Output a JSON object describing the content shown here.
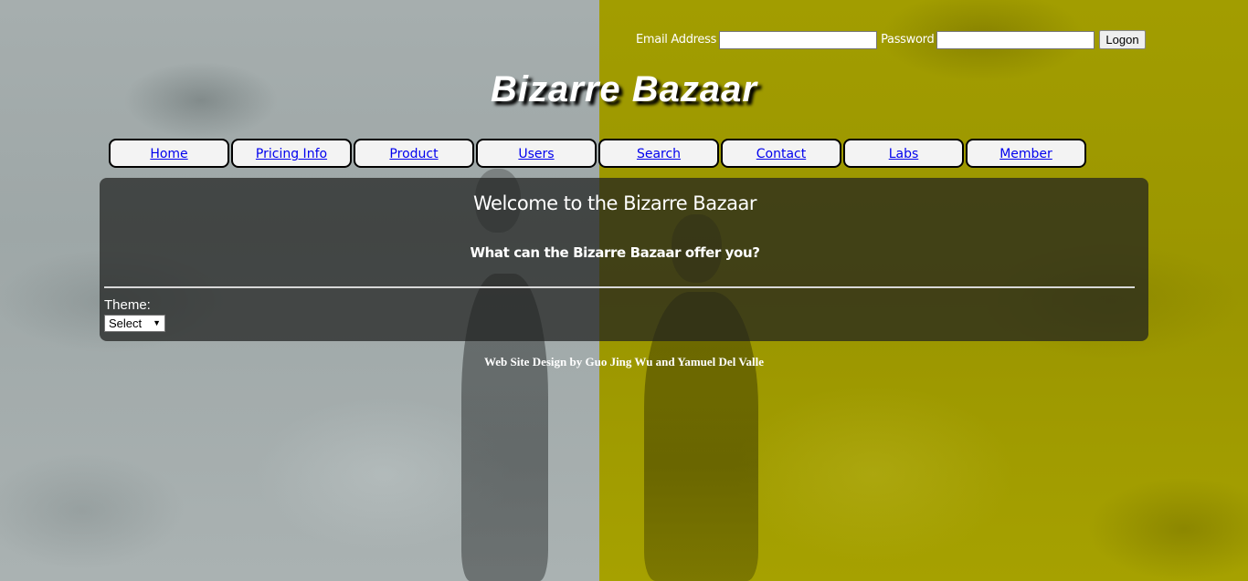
{
  "login": {
    "email_label": "Email Address",
    "email_value": "",
    "password_label": "Password",
    "password_value": "",
    "logon_label": "Logon"
  },
  "brand": {
    "title": "Bizarre Bazaar"
  },
  "nav": {
    "items": [
      {
        "label": "Home"
      },
      {
        "label": "Pricing Info"
      },
      {
        "label": "Product"
      },
      {
        "label": "Users"
      },
      {
        "label": "Search"
      },
      {
        "label": "Contact"
      },
      {
        "label": "Labs"
      },
      {
        "label": "Member"
      }
    ]
  },
  "main": {
    "heading": "Welcome to the Bizarre Bazaar",
    "subheading": "What can the Bizarre Bazaar offer you?",
    "theme_label": "Theme:",
    "theme_selected": "Select"
  },
  "footer": {
    "credit": "Web Site Design by Guo Jing Wu and Yamuel Del Valle"
  },
  "colors": {
    "left_background": "#a6aeae",
    "right_background": "#a29d00",
    "nav_link": "#0000ee",
    "panel": "#1e201e"
  }
}
